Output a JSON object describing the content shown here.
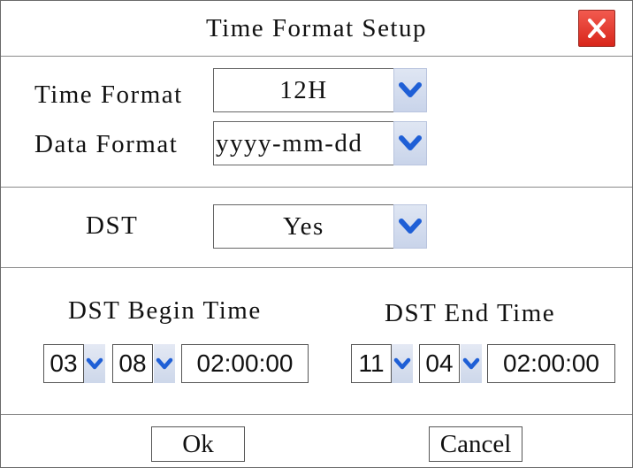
{
  "dialog": {
    "title": "Time Format Setup"
  },
  "time_format": {
    "label": "Time Format",
    "value": "12H"
  },
  "date_format": {
    "label": "Data Format",
    "value": "yyyy-mm-dd"
  },
  "dst": {
    "label": "DST",
    "value": "Yes"
  },
  "dst_begin": {
    "label": "DST Begin Time",
    "month": "03",
    "week": "08",
    "time": "02:00:00"
  },
  "dst_end": {
    "label": "DST End Time",
    "month": "11",
    "week": "04",
    "time": "02:00:00"
  },
  "buttons": {
    "ok": "Ok",
    "cancel": "Cancel"
  },
  "icons": {
    "close": "close-x-icon",
    "dropdown": "chevron-down-icon"
  },
  "colors": {
    "close_bg": "#e0372c",
    "arrow_bg": "#cfd9ec",
    "arrow_fg": "#1f5fd6"
  }
}
